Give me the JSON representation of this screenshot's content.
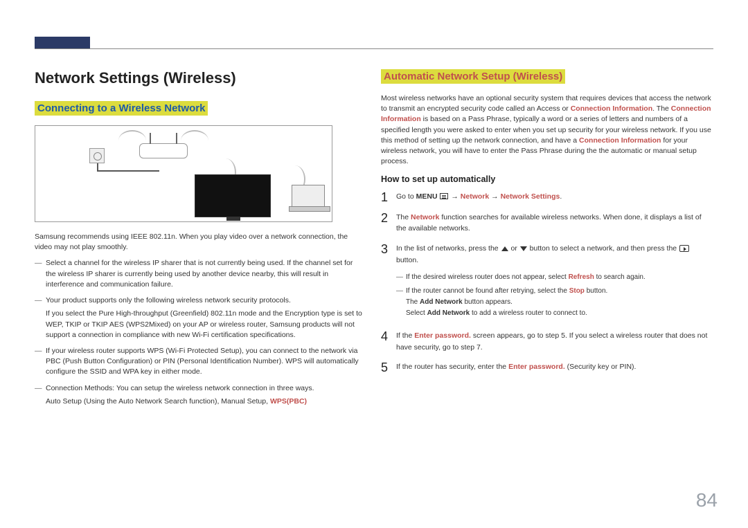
{
  "page_number": "84",
  "left": {
    "title": "Network Settings (Wireless)",
    "h2": "Connecting to a Wireless Network",
    "intro": "Samsung recommends using IEEE 802.11n. When you play video over a network connection, the video may not play smoothly.",
    "b1": "Select a channel for the wireless IP sharer that is not currently being used. If the channel set for the wireless IP sharer is currently being used by another device nearby, this will result in interference and communication failure.",
    "b2": "Your product supports only the following wireless network security protocols.",
    "b2_sub": "If you select the Pure High-throughput (Greenfield) 802.11n mode and the Encryption type is set to WEP, TKIP or TKIP AES (WPS2Mixed) on your AP or wireless router, Samsung products will not support a connection in compliance with new Wi-Fi certification specifications.",
    "b3": "If your wireless router supports WPS (Wi-Fi Protected Setup), you can connect to the network via PBC (Push Button Configuration) or PIN (Personal Identification Number). WPS will automatically configure the SSID and WPA key in either mode.",
    "b4": "Connection Methods: You can setup the wireless network connection in three ways.",
    "b4_sub_pre": "Auto Setup (Using the Auto Network Search function), Manual Setup, ",
    "b4_sub_red": "WPS(PBC)"
  },
  "right": {
    "h2": "Automatic Network Setup (Wireless)",
    "p1_a": "Most wireless networks have an optional security system that requires devices that access the network to transmit an encrypted security code called an Access or ",
    "p1_red1": "Connection Information",
    "p1_b": ". The ",
    "p1_red2": "Connection Information",
    "p1_c": " is based on a Pass Phrase, typically a word or a series of letters and numbers of a specified length you were asked to enter when you set up security for your wireless network. If you use this method of setting up the network connection, and have a ",
    "p1_red3": "Connection Information",
    "p1_d": " for your wireless network, you will have to enter the Pass Phrase during the the automatic or manual setup process.",
    "h3": "How to set up automatically",
    "steps": {
      "s1": {
        "a": "Go to ",
        "menu": "MENU",
        "arrow1": " → ",
        "net": "Network",
        "arrow2": " → ",
        "netset": "Network Settings",
        "end": "."
      },
      "s2": {
        "a": "The ",
        "red": "Network",
        "b": " function searches for available wireless networks. When done, it displays a list of the available networks."
      },
      "s3": {
        "a": "In the list of networks, press the ",
        "b": " or ",
        "c": " button to select a network, and then press the ",
        "d": " button.",
        "n1_a": "If the desired wireless router does not appear, select ",
        "n1_red": "Refresh",
        "n1_b": " to search again.",
        "n2_a": "If the router cannot be found after retrying, select the ",
        "n2_red": "Stop",
        "n2_b": " button.",
        "n2_c_a": "The ",
        "n2_c_bold": "Add Network",
        "n2_c_b": " button appears.",
        "n2_d_a": "Select ",
        "n2_d_bold": "Add Network",
        "n2_d_b": " to add a wireless router to connect to."
      },
      "s4": {
        "a": "If the ",
        "red": "Enter password.",
        "b": " screen appears, go to step 5. If you select a wireless router that does not have security, go to step 7."
      },
      "s5": {
        "a": "If the router has security, enter the ",
        "red": "Enter password.",
        "b": " (Security key or PIN)."
      }
    }
  }
}
